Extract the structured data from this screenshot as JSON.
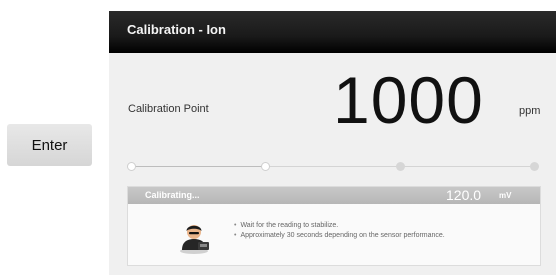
{
  "enter_button": {
    "label": "Enter"
  },
  "window": {
    "title": "Calibration - Ion"
  },
  "calibration": {
    "point_label": "Calibration Point",
    "value": "1000",
    "unit": "ppm"
  },
  "progress": {
    "total_steps": 4,
    "completed_steps": 2
  },
  "status": {
    "text": "Calibrating...",
    "reading": "120.0",
    "reading_unit": "mV",
    "instructions": [
      "Wait for the reading to stabilize.",
      "Approximately 30 seconds depending on the sensor performance."
    ]
  },
  "icons": {
    "person": "person-with-device-icon"
  },
  "colors": {
    "titlebar": "#1a1a1a",
    "status_bar": "#bdbdbd",
    "screen_bg": "#f0f0f0"
  }
}
